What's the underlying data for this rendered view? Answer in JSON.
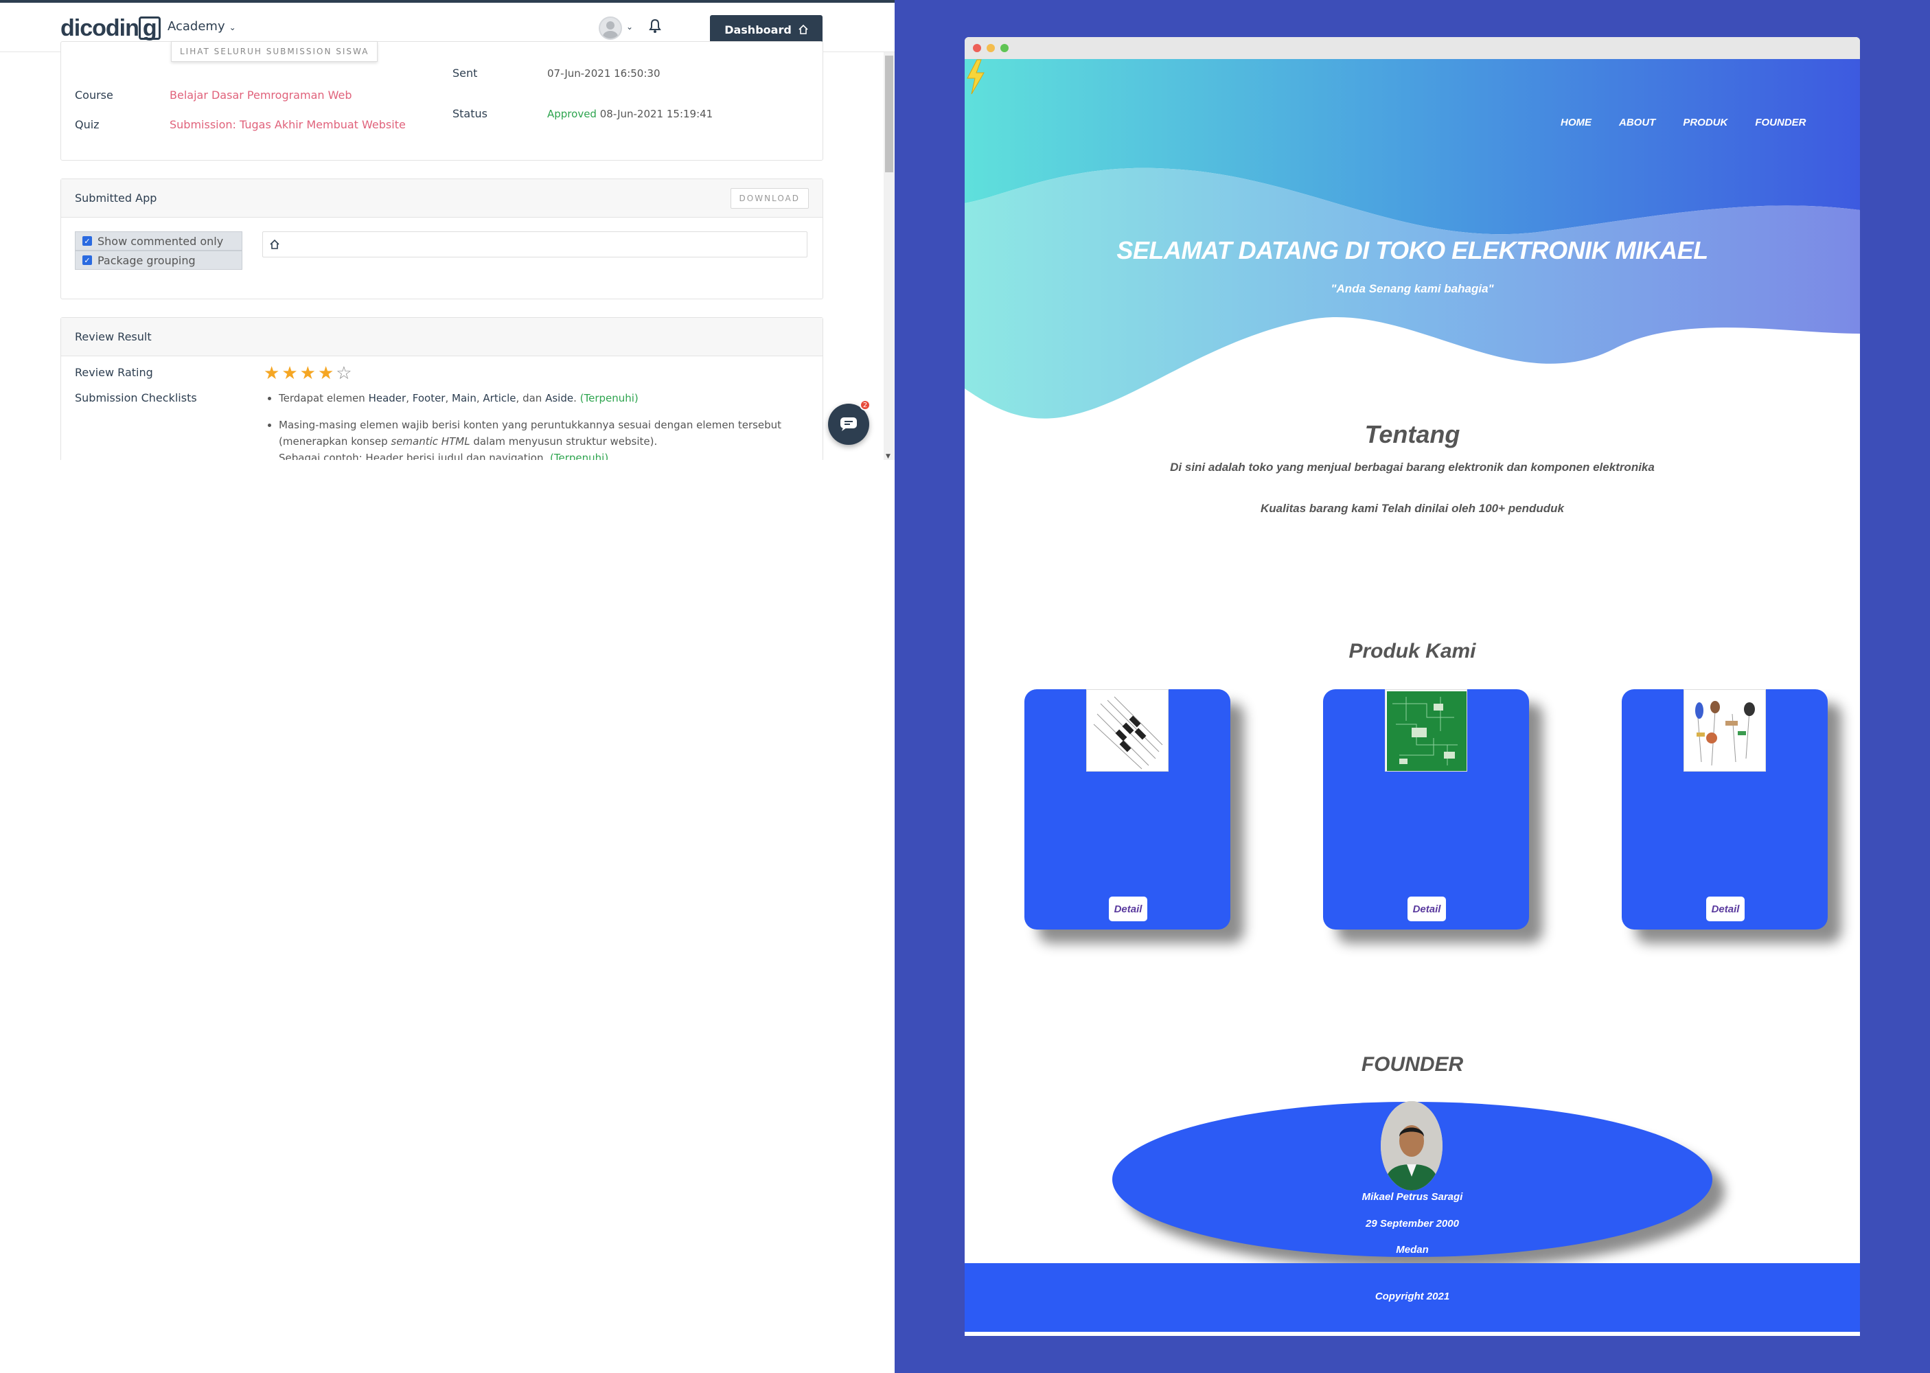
{
  "left": {
    "logo": {
      "text_main": "dicodin",
      "text_box": "g"
    },
    "nav": {
      "academy": "Academy"
    },
    "dashboard_button": "Dashboard",
    "submission": {
      "see_all_button": "LIHAT SELURUH SUBMISSION SISWA",
      "course_label": "Course",
      "course_value": "Belajar Dasar Pemrograman Web",
      "quiz_label": "Quiz",
      "quiz_value": "Submission: Tugas Akhir Membuat Website",
      "sent_label": "Sent",
      "sent_value": "07-Jun-2021 16:50:30",
      "status_label": "Status",
      "status_value": "Approved",
      "status_date": "08-Jun-2021 15:19:41"
    },
    "submitted_app": {
      "title": "Submitted App",
      "download_button": "DOWNLOAD",
      "show_commented": "Show commented only",
      "package_grouping": "Package grouping"
    },
    "review": {
      "title": "Review Result",
      "rating_label": "Review Rating",
      "rating": 4,
      "rating_max": 5,
      "checklist_label": "Submission Checklists",
      "item1_prefix": "Terdapat elemen",
      "item1_header": "Header",
      "item1_footer": "Footer",
      "item1_main": "Main",
      "item1_article": "Article",
      "item1_dan": "dan",
      "item1_aside": "Aside",
      "item1_status": "(Terpenuhi)",
      "item2_line1": "Masing-masing elemen wajib berisi konten yang peruntukkannya sesuai dengan elemen tersebut",
      "item2_line2a": "(menerapkan konsep",
      "item2_line2b": "semantic HTML",
      "item2_line2c": "dalam menyusun struktur website).",
      "item2_line3": "Sebagai contoh: Header berisi judul dan navigation.",
      "item2_status": "(Terpenuhi)"
    },
    "chat_badge": "2"
  },
  "site": {
    "nav": [
      "HOME",
      "ABOUT",
      "PRODUK",
      "FOUNDER"
    ],
    "hero_title": "SELAMAT DATANG DI TOKO ELEKTRONIK MIKAEL",
    "hero_quote": "\"Anda Senang kami bahagia\"",
    "about_title": "Tentang",
    "about_text1": "Di sini adalah toko yang menjual berbagai barang elektronik dan komponen elektronika",
    "about_text2": "Kualitas barang kami Telah dinilai oleh 100+ penduduk",
    "products_title": "Produk Kami",
    "products": [
      {
        "image": "diodes-image",
        "button": "Detail"
      },
      {
        "image": "pcb-image",
        "button": "Detail"
      },
      {
        "image": "components-image",
        "button": "Detail"
      }
    ],
    "founder_title": "FOUNDER",
    "founder_name": "Mikael Petrus Saragi",
    "founder_dob": "29 September 2000",
    "founder_city": "Medan",
    "footer": "Copyright 2021",
    "colors": {
      "page_bg": "#3d4eb8",
      "card_blue": "#2c5bf5",
      "hero_teal": "#5fe0dc",
      "hero_blue": "#3d5ae0"
    }
  }
}
